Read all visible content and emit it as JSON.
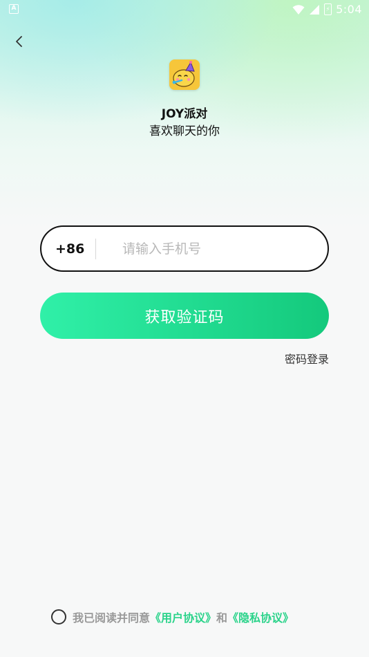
{
  "status_bar": {
    "app_icon_letter": "A",
    "time": "5:04",
    "battery_glyph": "⚡"
  },
  "login": {
    "app_name": "JOY派对",
    "slogan": "喜欢聊天的你",
    "country_code": "+86",
    "phone_placeholder": "请输入手机号",
    "phone_value": "",
    "get_code_label": "获取验证码",
    "password_login_label": "密码登录"
  },
  "agreement": {
    "prefix": "我已阅读并同意",
    "user_agreement": "《用户协议》",
    "and": "和",
    "privacy_policy": "《隐私协议》",
    "checked": false
  },
  "colors": {
    "accent_start": "#30f0a8",
    "accent_end": "#14c97c",
    "link": "#2ad38a",
    "logo_bg": "#f6c63a"
  },
  "icons": {
    "back": "chevron-left-icon",
    "logo": "party-face-logo-icon",
    "wifi": "wifi-icon",
    "signal": "signal-icon",
    "battery": "battery-icon"
  }
}
